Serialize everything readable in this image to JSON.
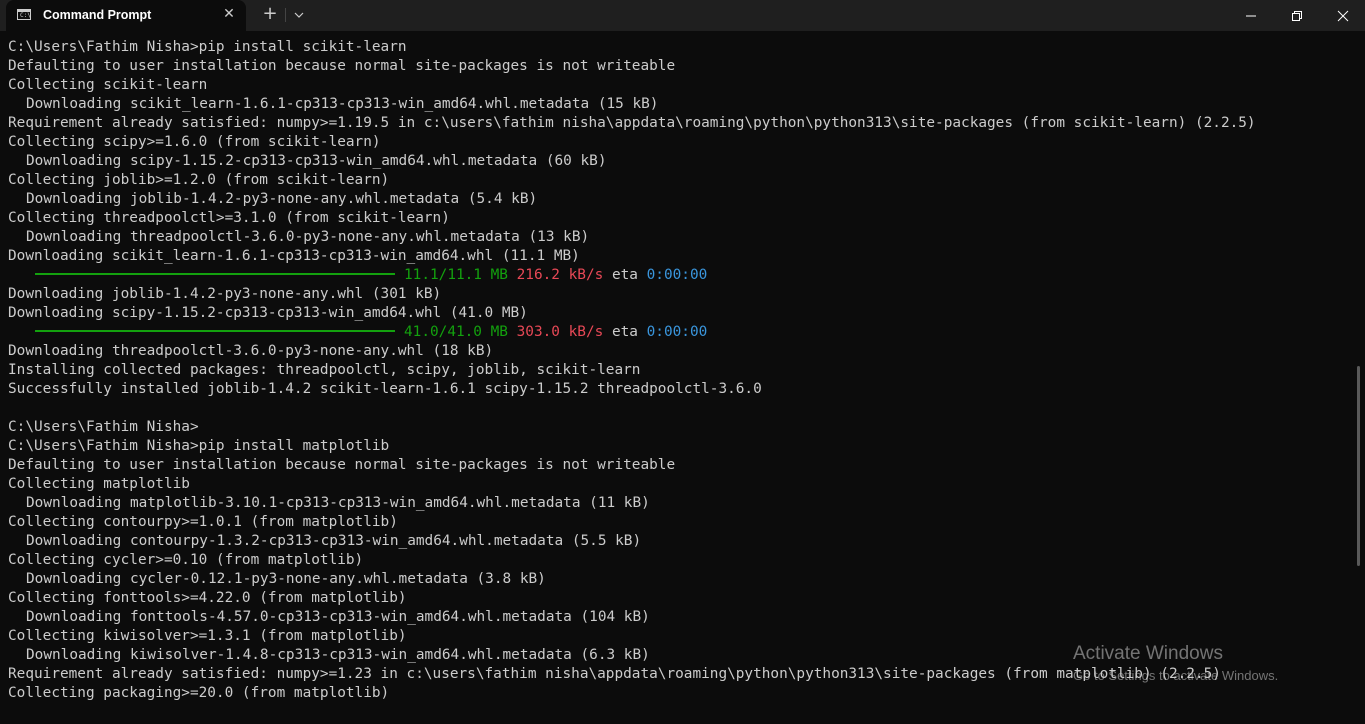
{
  "window": {
    "tab_title": "Command Prompt",
    "tab_icon": "cmd-icon",
    "close_tab_glyph": "✕",
    "new_tab_glyph": "+",
    "icons": [
      "cmd-icon",
      "close-icon",
      "plus-icon",
      "chevron-down-icon",
      "minimize-icon",
      "maximize-icon",
      "close-icon"
    ]
  },
  "terminal": {
    "lines": [
      "C:\\Users\\Fathim Nisha>pip install scikit-learn",
      "Defaulting to user installation because normal site-packages is not writeable",
      "Collecting scikit-learn",
      "Downloading scikit_learn-1.6.1-cp313-cp313-win_amd64.whl.metadata (15 kB)",
      "Requirement already satisfied: numpy>=1.19.5 in c:\\users\\fathim nisha\\appdata\\roaming\\python\\python313\\site-packages (from scikit-learn) (2.2.5)",
      "Collecting scipy>=1.6.0 (from scikit-learn)",
      "Downloading scipy-1.15.2-cp313-cp313-win_amd64.whl.metadata (60 kB)",
      "Collecting joblib>=1.2.0 (from scikit-learn)",
      "Downloading joblib-1.4.2-py3-none-any.whl.metadata (5.4 kB)",
      "Collecting threadpoolctl>=3.1.0 (from scikit-learn)",
      "Downloading threadpoolctl-3.6.0-py3-none-any.whl.metadata (13 kB)",
      "Downloading scikit_learn-1.6.1-cp313-cp313-win_amd64.whl (11.1 MB)",
      "Downloading joblib-1.4.2-py3-none-any.whl (301 kB)",
      "Downloading scipy-1.15.2-cp313-cp313-win_amd64.whl (41.0 MB)",
      "Downloading threadpoolctl-3.6.0-py3-none-any.whl (18 kB)",
      "Installing collected packages: threadpoolctl, scipy, joblib, scikit-learn",
      "Successfully installed joblib-1.4.2 scikit-learn-1.6.1 scipy-1.15.2 threadpoolctl-3.6.0",
      "",
      "C:\\Users\\Fathim Nisha>",
      "C:\\Users\\Fathim Nisha>pip install matplotlib",
      "Defaulting to user installation because normal site-packages is not writeable",
      "Collecting matplotlib",
      "Downloading matplotlib-3.10.1-cp313-cp313-win_amd64.whl.metadata (11 kB)",
      "Collecting contourpy>=1.0.1 (from matplotlib)",
      "Downloading contourpy-1.3.2-cp313-cp313-win_amd64.whl.metadata (5.5 kB)",
      "Collecting cycler>=0.10 (from matplotlib)",
      "Downloading cycler-0.12.1-py3-none-any.whl.metadata (3.8 kB)",
      "Collecting fonttools>=4.22.0 (from matplotlib)",
      "Downloading fonttools-4.57.0-cp313-cp313-win_amd64.whl.metadata (104 kB)",
      "Collecting kiwisolver>=1.3.1 (from matplotlib)",
      "Downloading kiwisolver-1.4.8-cp313-cp313-win_amd64.whl.metadata (6.3 kB)",
      "Requirement already satisfied: numpy>=1.23 in c:\\users\\fathim nisha\\appdata\\roaming\\python\\python313\\site-packages (from matplotlib) (2.2.5)",
      "Collecting packaging>=20.0 (from matplotlib)"
    ],
    "progress": [
      {
        "size": "11.1/11.1 MB",
        "speed": "216.2 kB/s",
        "eta_label": "eta",
        "eta": "0:00:00",
        "fraction": 1.0
      },
      {
        "size": "41.0/41.0 MB",
        "speed": "303.0 kB/s",
        "eta_label": "eta",
        "eta": "0:00:00",
        "fraction": 1.0
      }
    ]
  },
  "watermark": {
    "title": "Activate Windows",
    "subtitle": "Go to Settings to activate Windows."
  },
  "colors": {
    "background": "#0c0c0c",
    "text": "#cccccc",
    "progress_green": "#13a10e",
    "speed_red": "#e74856",
    "eta_blue": "#3a96dd",
    "titlebar": "#1f1f1f"
  }
}
